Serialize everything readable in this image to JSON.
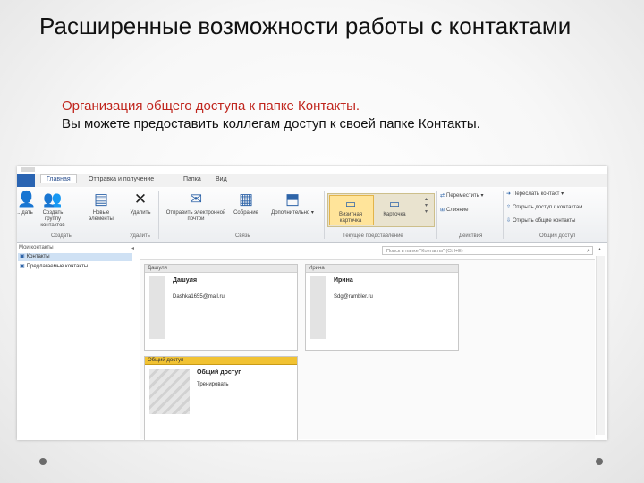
{
  "slide": {
    "title": "Расширенные возможности работы с контактами",
    "subtitle": "Организация общего доступа к папке Контакты.",
    "text": "Вы можете предоставить коллегам доступ к своей папке Контакты."
  },
  "outlook": {
    "tabs": [
      "Главная",
      "Отправка и получение",
      "Папка",
      "Вид"
    ],
    "ribbon": {
      "buttons": [
        {
          "label": "...дать",
          "icon": "new-contact-icon"
        },
        {
          "label": "Создать группу контактов",
          "icon": "new-group-icon"
        },
        {
          "label": "Новые элементы",
          "icon": "new-items-icon"
        },
        {
          "label": "Удалить",
          "icon": "delete-icon"
        },
        {
          "label": "Отправить электронной почтой",
          "icon": "email-icon"
        },
        {
          "label": "Собрание",
          "icon": "meeting-icon"
        },
        {
          "label": "Дополнительно",
          "icon": "more-icon"
        },
        {
          "label": "Визитная карточка",
          "icon": "business-card-icon"
        },
        {
          "label": "Карточка",
          "icon": "card-icon"
        }
      ],
      "groups": [
        "Создать",
        "Удалить",
        "Связь",
        "Текущее представление",
        "Действия",
        "Общий доступ"
      ],
      "actions": [
        "Переместить",
        "Слияние"
      ],
      "share": [
        "Переслать контакт",
        "Открыть доступ к контактам",
        "Открыть общие контакты"
      ]
    },
    "nav": {
      "header": "Мои контакты",
      "items": [
        "Контакты",
        "Предлагаемые контакты"
      ]
    },
    "search_placeholder": "Поиск в папке \"Контакты\" (Ctrl+E)",
    "contacts": [
      {
        "header": "Дашуля",
        "name": "Дашуля",
        "email": "Dashka1655@mail.ru"
      },
      {
        "header": "Ирина",
        "name": "Ирина",
        "email": "Sdg@rambler.ru"
      },
      {
        "header": "Общий доступ",
        "name": "Общий доступ",
        "sub": "Тренировать"
      }
    ]
  }
}
